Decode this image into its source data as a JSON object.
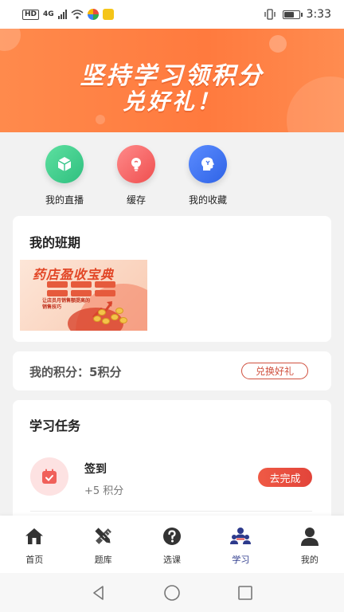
{
  "status_bar": {
    "badge_hd": "HD",
    "network": "4G",
    "time": "3:33",
    "battery_level": 0.7
  },
  "banner": {
    "line1": "坚持学习领积分",
    "line2": "兑好礼！",
    "color": "#ff7a3e"
  },
  "quick_links": [
    {
      "label": "我的直播",
      "icon": "cube-icon",
      "color": "#3fcf8e"
    },
    {
      "label": "缓存",
      "icon": "lightbulb-icon",
      "color": "#f35b5b"
    },
    {
      "label": "我的收藏",
      "icon": "head-icon",
      "color": "#3b6ff2"
    }
  ],
  "my_class": {
    "title": "我的班期",
    "course_image_title": "药店盈收宝典",
    "course_image_subtitle": "让店员月销售额提高的销售技巧"
  },
  "points": {
    "text": "我的积分：5积分",
    "exchange_label": "兑换好礼"
  },
  "tasks": {
    "title": "学习任务",
    "items": [
      {
        "name": "签到",
        "points": "+5 积分",
        "action": "去完成",
        "icon": "calendar-check-icon"
      }
    ]
  },
  "bottom_nav": {
    "items": [
      {
        "label": "首页",
        "icon": "home-icon",
        "active": false
      },
      {
        "label": "题库",
        "icon": "pencil-ruler-icon",
        "active": false
      },
      {
        "label": "选课",
        "icon": "question-icon",
        "active": false
      },
      {
        "label": "学习",
        "icon": "study-group-icon",
        "active": true
      },
      {
        "label": "我的",
        "icon": "user-icon",
        "active": false
      }
    ],
    "active_color": "#2d3a8c"
  },
  "system_nav": {
    "icons": [
      "back-icon",
      "home-circle-icon",
      "recents-icon"
    ]
  }
}
